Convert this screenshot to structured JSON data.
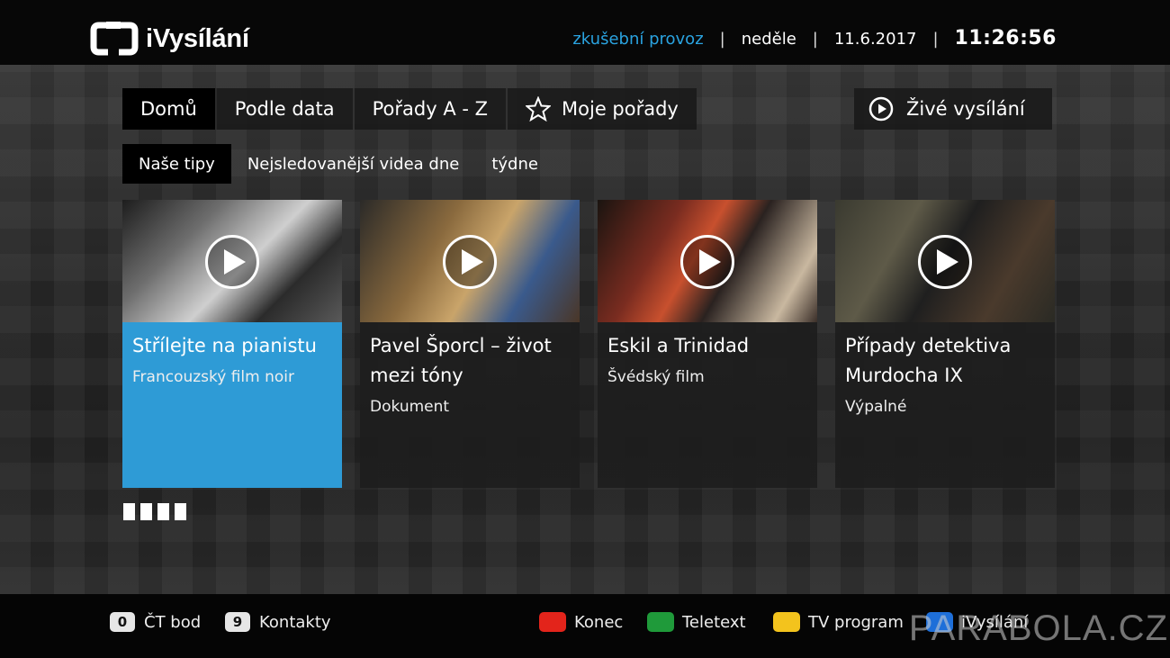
{
  "header": {
    "app_title": "iVysílání",
    "status": "zkušební provoz",
    "day": "neděle",
    "date": "11.6.2017",
    "time": "11:26:56",
    "separator": "|"
  },
  "nav": {
    "items": [
      {
        "label": "Domů",
        "active": true
      },
      {
        "label": "Podle data"
      },
      {
        "label": "Pořady A - Z"
      },
      {
        "label": "Moje pořady",
        "icon": "star-icon"
      }
    ],
    "live": {
      "label": "Živé vysílání",
      "icon": "play-circle-icon"
    }
  },
  "subnav": {
    "items": [
      {
        "label": "Naše tipy",
        "active": true
      },
      {
        "label": "Nejsledovanější videa dne"
      },
      {
        "label": "týdne"
      }
    ]
  },
  "cards": [
    {
      "title": "Střílejte na pianistu",
      "subtitle": "Francouzský film noir",
      "selected": true
    },
    {
      "title": "Pavel Šporcl – život mezi tóny",
      "subtitle": "Dokument"
    },
    {
      "title": "Eskil a Trinidad",
      "subtitle": "Švédský film"
    },
    {
      "title": "Případy detektiva Murdocha IX",
      "subtitle": "Výpalné"
    }
  ],
  "pager": {
    "pages": 4
  },
  "footer": {
    "number_keys": [
      {
        "key": "0",
        "label": "ČT bod"
      },
      {
        "key": "9",
        "label": "Kontakty"
      }
    ],
    "color_keys": [
      {
        "color": "#e3241b",
        "label": "Konec"
      },
      {
        "color": "#1f9a3a",
        "label": "Teletext"
      },
      {
        "color": "#f3c31d",
        "label": "TV program"
      },
      {
        "color": "#1e6fd9",
        "label": "iVysílání"
      }
    ]
  },
  "watermark": "PARABOLA.CZ",
  "colors": {
    "accent": "#2e9bd6",
    "trial": "#2aa3e0"
  }
}
